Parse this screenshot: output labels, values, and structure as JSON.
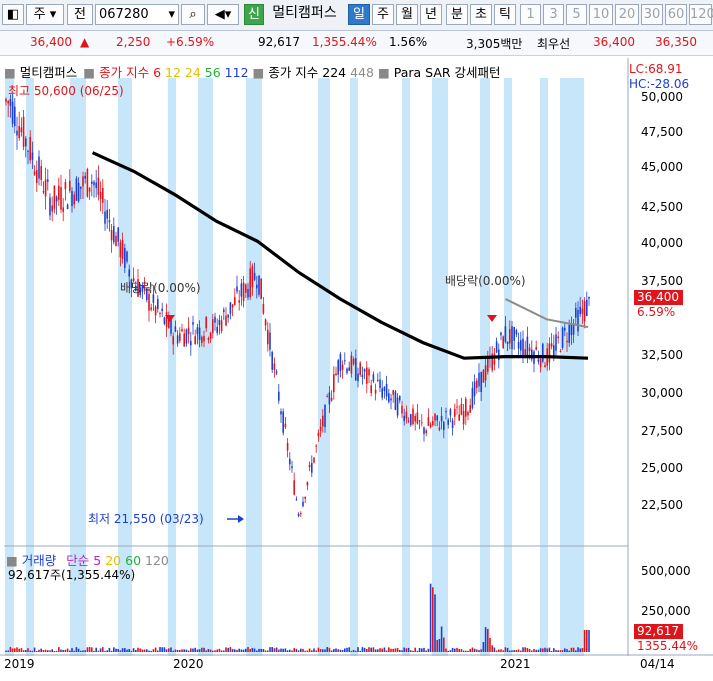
{
  "toolbar": {
    "market_label": "주",
    "prev_label": "전",
    "code": "067280",
    "new_label": "신",
    "name": "멀티캠퍼스",
    "period_day": "일",
    "period_week": "주",
    "period_month": "월",
    "period_year": "년",
    "period_minute": "분",
    "period_second": "초",
    "period_tick": "틱",
    "intervals": [
      "1",
      "3",
      "5",
      "10",
      "20",
      "30",
      "60",
      "120"
    ]
  },
  "quote": {
    "price": "36,400",
    "arrow": "▲",
    "change": "2,250",
    "change_pct": "+6.59%",
    "volume": "92,617",
    "volume_pct": "1,355.44%",
    "turnover_pct": "1.56%",
    "amount": "3,305백만",
    "best_label": "최우선",
    "ask": "36,400",
    "bid": "36,350"
  },
  "legend": {
    "name": "멀티캠퍼스",
    "ma_title": "종가 지수",
    "ma_periods": [
      "6",
      "12",
      "24",
      "56",
      "112"
    ],
    "ma2_title": "종가 지수",
    "ma2_periods": [
      "224",
      "448"
    ],
    "sar_label": "Para SAR 강세패턴",
    "lc": "LC:68.91",
    "hc": "HC:-28.06"
  },
  "volume_legend": {
    "title": "거래량",
    "ma_title": "단순",
    "periods": [
      "5",
      "20",
      "60",
      "120"
    ],
    "value": "92,617주(1,355.44%)"
  },
  "annotations": {
    "high": "최고 50,600 (06/25)",
    "low": "최저 21,550 (03/23)",
    "dividend1": "배당락(0.00%)",
    "dividend2": "배당락(0.00%)",
    "price_tag": "36,400",
    "pct_tag": "6.59%",
    "vol_tag": "92,617",
    "vol_pct_tag": "1355.44%"
  },
  "colors": {
    "candle_up": "#e0151b",
    "candle_down": "#1c3fd1",
    "highlight_band": "#c8e6fa",
    "ma6": "#e0151b",
    "ma12": "#f0d20a",
    "ma24": "#1db337",
    "ma56": "#2a7a3a",
    "ma112": "#1c3fd1",
    "ma224": "#000000",
    "ma448": "#8c8c8c"
  },
  "chart_data": {
    "type": "line",
    "x": [
      "2019-01",
      "2019-03",
      "2019-05",
      "2019-07",
      "2019-09",
      "2019-11",
      "2020-01",
      "2020-03",
      "2020-05",
      "2020-07",
      "2020-09",
      "2020-11",
      "2021-01",
      "2021-03",
      "2021-04"
    ],
    "series": [
      {
        "name": "멀티캠퍼스",
        "values": [
          49500,
          43000,
          44500,
          38000,
          34500,
          35000,
          38500,
          23000,
          33000,
          31000,
          28500,
          29500,
          34500,
          33000,
          36400
        ]
      },
      {
        "name": "224",
        "values": [
          null,
          null,
          46200,
          45000,
          43500,
          41800,
          40500,
          38500,
          36800,
          35300,
          34000,
          33000,
          33100,
          33100,
          33000
        ]
      },
      {
        "name": "448",
        "values": [
          null,
          null,
          null,
          null,
          null,
          null,
          null,
          null,
          null,
          null,
          null,
          null,
          36800,
          35500,
          35000
        ]
      }
    ],
    "ylim": [
      21000,
      51000
    ],
    "y_ticks": [
      "22,500",
      "25,000",
      "27,500",
      "30,000",
      "32,500",
      "35,000",
      "37,500",
      "40,000",
      "42,500",
      "45,000",
      "47,500",
      "50,000"
    ],
    "volume_ticks": [
      "250,000",
      "500,000"
    ],
    "x_ticks": [
      "2019",
      "2020",
      "2021",
      "04/14"
    ],
    "grid": false
  }
}
